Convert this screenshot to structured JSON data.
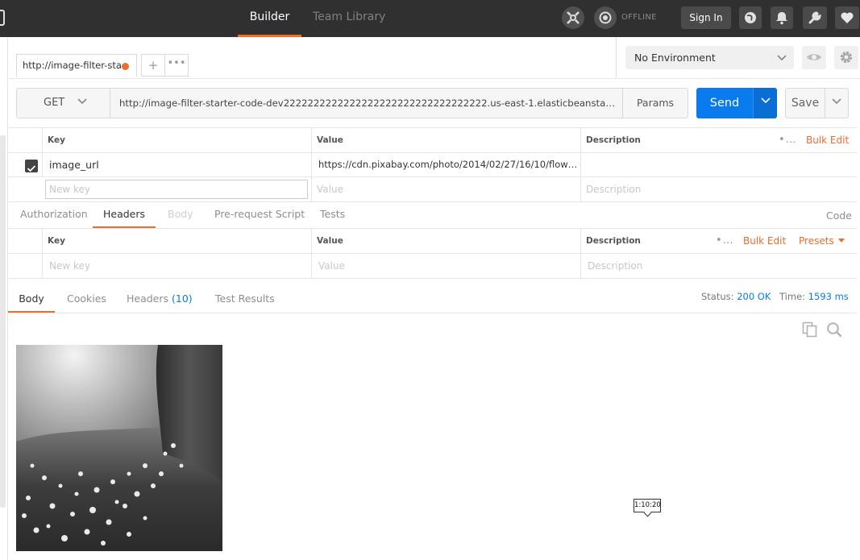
{
  "topbar": {
    "tabs": [
      {
        "label": "Builder",
        "active": true
      },
      {
        "label": "Team Library",
        "active": false
      }
    ],
    "status": "OFFLINE",
    "sign_in": "Sign In",
    "accent": "#ef6c2a"
  },
  "request_tab": {
    "title": "http://image-filter-sta",
    "unsaved": true
  },
  "environment": {
    "selected": "No Environment"
  },
  "request": {
    "method": "GET",
    "url": "http://image-filter-starter-code-dev2222222222222222222222222222222222.us-east-1.elasticbeanstalk.co...",
    "params_label": "Params",
    "send_label": "Send",
    "save_label": "Save"
  },
  "params_table": {
    "headers": {
      "key": "Key",
      "value": "Value",
      "description": "Description",
      "bulk_edit": "Bulk Edit"
    },
    "rows": [
      {
        "checked": true,
        "key": "image_url",
        "value": "https://cdn.pixabay.com/photo/2014/02/27/16/10/flowe...",
        "description": ""
      }
    ],
    "placeholder": {
      "key": "New key",
      "value": "Value",
      "description": "Description"
    }
  },
  "request_subtabs": {
    "tabs": [
      "Authorization",
      "Headers",
      "Body",
      "Pre-request Script",
      "Tests"
    ],
    "active": "Headers",
    "code_label": "Code"
  },
  "headers_table": {
    "headers": {
      "key": "Key",
      "value": "Value",
      "description": "Description",
      "bulk_edit": "Bulk Edit",
      "presets": "Presets"
    },
    "placeholder": {
      "key": "New key",
      "value": "Value",
      "description": "Description"
    }
  },
  "response": {
    "tabs": {
      "body": "Body",
      "cookies": "Cookies",
      "headers": "Headers",
      "headers_count": "(10)",
      "test_results": "Test Results"
    },
    "status_label": "Status:",
    "status_value": "200 OK",
    "time_label": "Time:",
    "time_value": "1593 ms"
  },
  "tooltip": {
    "text": "1:10:20"
  }
}
